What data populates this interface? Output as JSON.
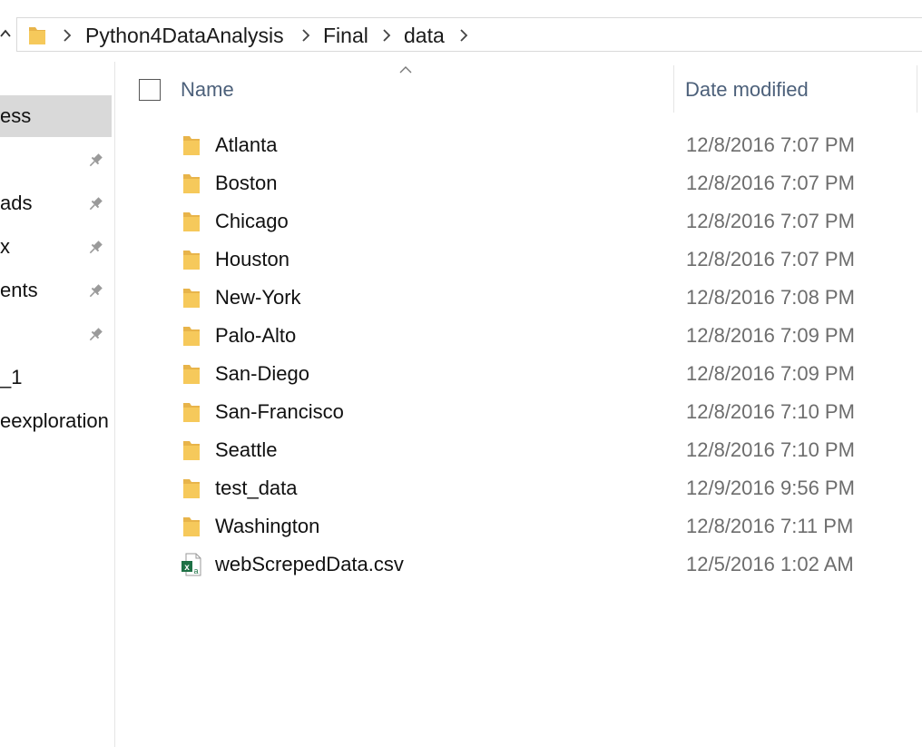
{
  "breadcrumb": {
    "items": [
      "Python4DataAnalysis",
      "Final",
      "data"
    ]
  },
  "nav": {
    "items": [
      {
        "label": "ess",
        "pinned": false,
        "selected": true
      },
      {
        "label": "",
        "pinned": true,
        "selected": false
      },
      {
        "label": "ads",
        "pinned": true,
        "selected": false
      },
      {
        "label": "x",
        "pinned": true,
        "selected": false
      },
      {
        "label": "ents",
        "pinned": true,
        "selected": false
      },
      {
        "label": "",
        "pinned": true,
        "selected": false
      },
      {
        "label": "_1",
        "pinned": false,
        "selected": false
      },
      {
        "label": "eexploration",
        "pinned": false,
        "selected": false
      }
    ]
  },
  "columns": {
    "name": "Name",
    "date_modified": "Date modified"
  },
  "files": [
    {
      "name": "Atlanta",
      "date": "12/8/2016 7:07 PM",
      "type": "folder"
    },
    {
      "name": "Boston",
      "date": "12/8/2016 7:07 PM",
      "type": "folder"
    },
    {
      "name": "Chicago",
      "date": "12/8/2016 7:07 PM",
      "type": "folder"
    },
    {
      "name": "Houston",
      "date": "12/8/2016 7:07 PM",
      "type": "folder"
    },
    {
      "name": "New-York",
      "date": "12/8/2016 7:08 PM",
      "type": "folder"
    },
    {
      "name": "Palo-Alto",
      "date": "12/8/2016 7:09 PM",
      "type": "folder"
    },
    {
      "name": "San-Diego",
      "date": "12/8/2016 7:09 PM",
      "type": "folder"
    },
    {
      "name": "San-Francisco",
      "date": "12/8/2016 7:10 PM",
      "type": "folder"
    },
    {
      "name": "Seattle",
      "date": "12/8/2016 7:10 PM",
      "type": "folder"
    },
    {
      "name": "test_data",
      "date": "12/9/2016 9:56 PM",
      "type": "folder"
    },
    {
      "name": "Washington",
      "date": "12/8/2016 7:11 PM",
      "type": "folder"
    },
    {
      "name": "webScrepedData.csv",
      "date": "12/5/2016 1:02 AM",
      "type": "csv"
    }
  ],
  "colors": {
    "folder": "#f6c95b",
    "header_text": "#4c607a",
    "selected_nav": "#d9d9d9",
    "excel_green": "#1e7145"
  },
  "icons": {
    "folder": "folder-icon",
    "csv": "excel-csv-file-icon",
    "pin": "pin-icon",
    "chevron": "chevron-right-icon",
    "up": "up-arrow-icon",
    "sort": "sort-ascending-caret-icon"
  }
}
